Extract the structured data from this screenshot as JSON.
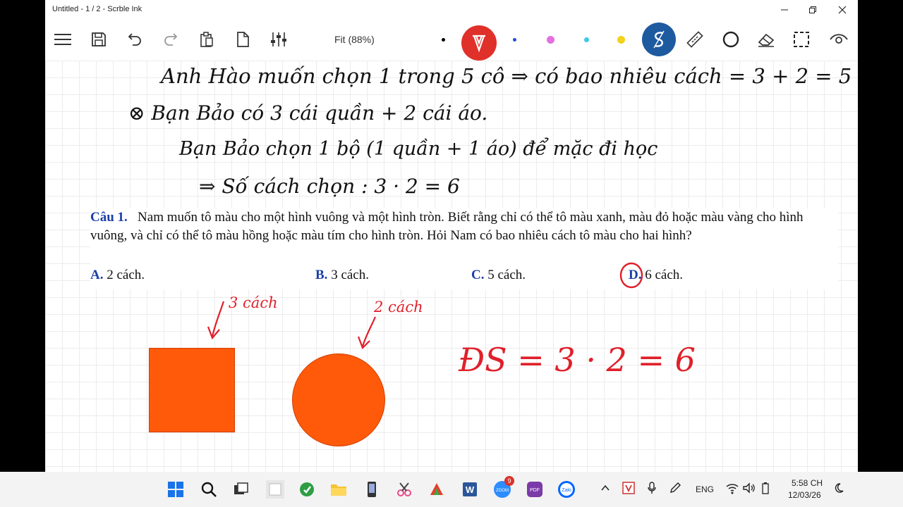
{
  "window": {
    "title": "Untitled - 1 / 2 - Scrble Ink"
  },
  "toolbar": {
    "zoom_label": "Fit (88%)",
    "pen_colors": [
      "#000000",
      "#1e4fd8",
      "#e36fe0",
      "#3cc9e8",
      "#f2d21b"
    ],
    "active_pen_color": "#d8322b",
    "active_tool_color": "#1e5aa0"
  },
  "handwriting": {
    "line1": "Anh Hào muốn chọn 1 trong 5 cô ⇒ có bao nhiêu cách = 3 + 2 = 5",
    "line2": "⊗ Bạn Bảo có 3 cái quần + 2 cái áo.",
    "line3": "Bạn Bảo chọn 1 bộ (1 quần + 1 áo) để mặc đi học",
    "line4": "⇒ Số cách chọn : 3 · 2 = 6",
    "square_note": "3 cách",
    "circle_note": "2 cách",
    "answer": "ĐS = 3 · 2 = 6"
  },
  "question": {
    "label": "Câu 1.",
    "text": "Nam muốn tô màu cho một hình vuông và một hình tròn. Biết rằng chỉ có thể tô màu xanh, màu đỏ hoặc màu vàng cho hình vuông, và chỉ có thể tô màu hồng hoặc màu tím cho hình tròn. Hỏi Nam có bao nhiêu cách tô màu cho hai hình?",
    "options": [
      {
        "key": "A.",
        "text": "2 cách."
      },
      {
        "key": "B.",
        "text": "3 cách."
      },
      {
        "key": "C.",
        "text": "5 cách."
      },
      {
        "key": "D.",
        "text": "6 cách."
      }
    ],
    "circled_option": "D."
  },
  "shapes": {
    "fill": "#ff5a0a",
    "stroke": "#d23d00"
  },
  "taskbar": {
    "lang": "ENG",
    "time": "5:58 CH",
    "date": "12/03/26",
    "zoom_badge": "9",
    "zoom_label": "ZOOM",
    "pdf_label": "PDF",
    "zalo_label": "Zalo"
  }
}
